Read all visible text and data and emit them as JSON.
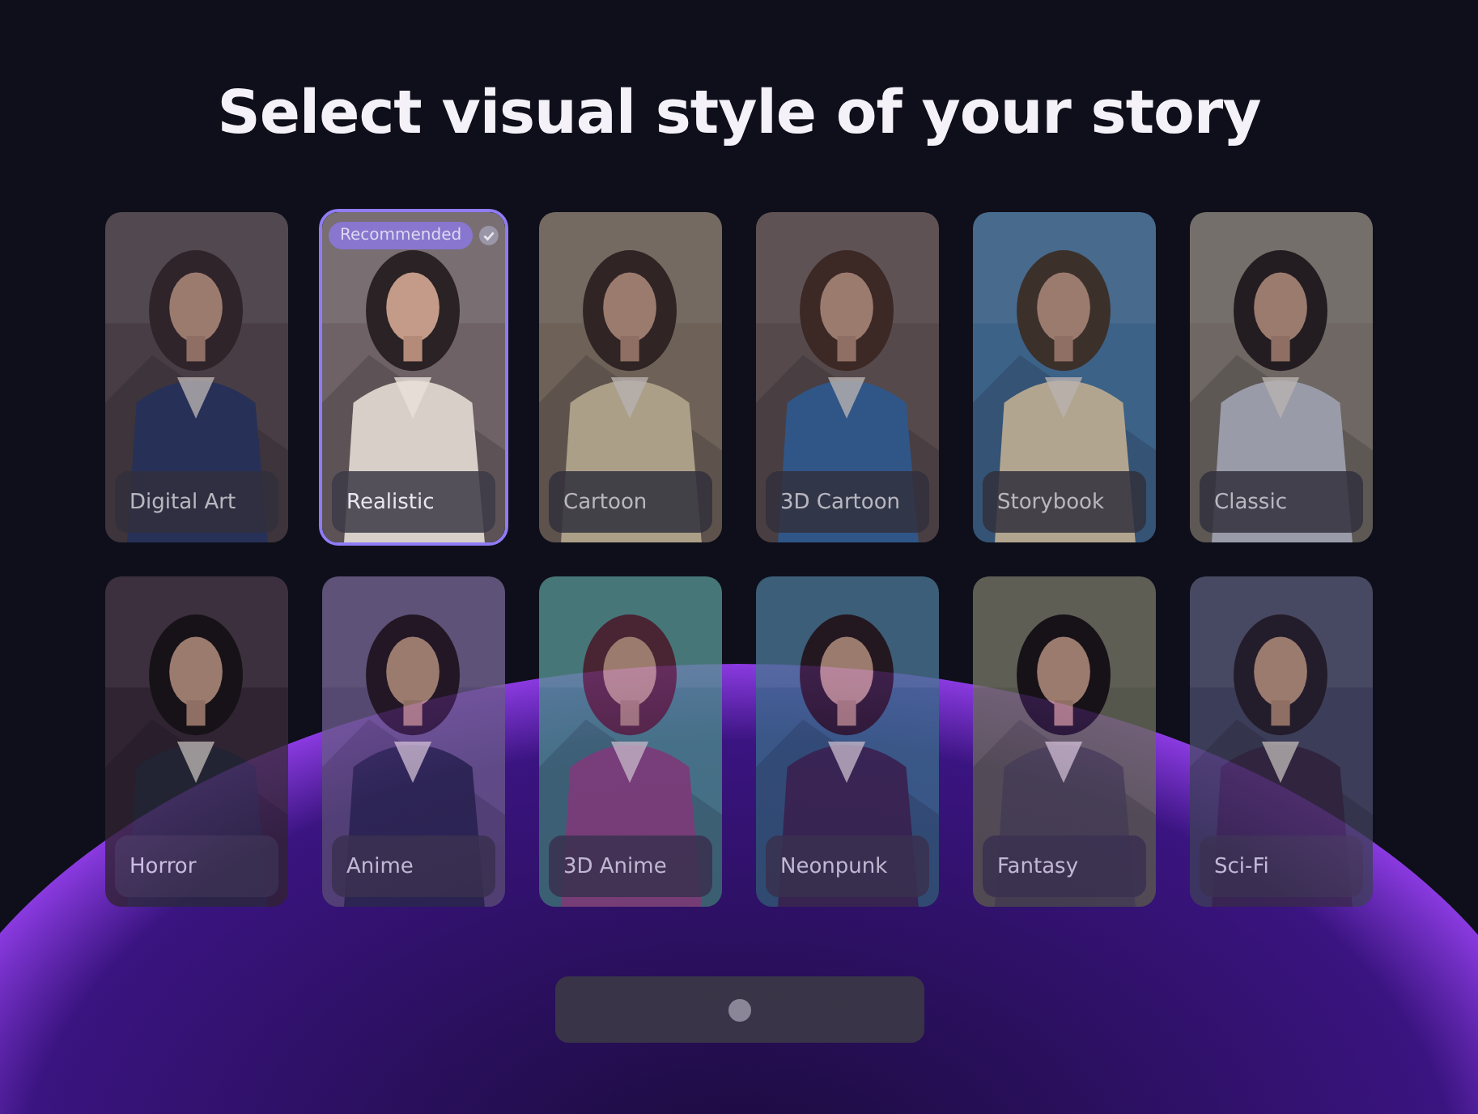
{
  "title": "Select visual style of your story",
  "styles": [
    {
      "label": "Digital Art",
      "selected": false
    },
    {
      "label": "Realistic",
      "selected": true,
      "badge": "Recommended"
    },
    {
      "label": "Cartoon",
      "selected": false
    },
    {
      "label": "3D Cartoon",
      "selected": false
    },
    {
      "label": "Storybook",
      "selected": false
    },
    {
      "label": "Classic",
      "selected": false
    },
    {
      "label": "Horror",
      "selected": false
    },
    {
      "label": "Anime",
      "selected": false
    },
    {
      "label": "3D Anime",
      "selected": false
    },
    {
      "label": "Neonpunk",
      "selected": false
    },
    {
      "label": "Fantasy",
      "selected": false
    },
    {
      "label": "Sci-Fi",
      "selected": false
    }
  ]
}
